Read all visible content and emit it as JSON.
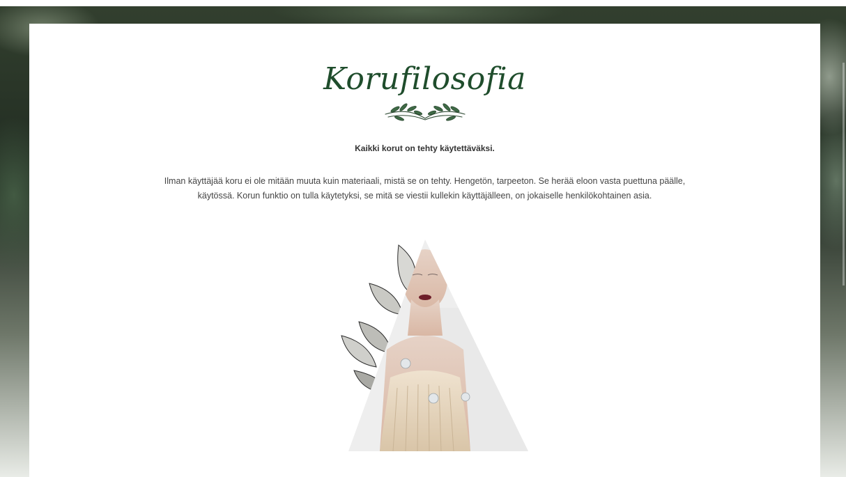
{
  "page": {
    "title": "Korufilosofia",
    "subheading": "Kaikki korut on tehty käytettäväksi.",
    "body": "Ilman käyttäjää koru ei ole mitään muuta kuin materiaali, mistä se on tehty. Hengetön, tarpeeton. Se herää eloon vasta puettuna päälle, käytössä. Korun funktio on tulla käytetyksi, se mitä se viestii kullekin käyttäjälleen, on jokaiselle henkilökohtainen asia."
  },
  "icons": {
    "ornament": "leaf-branch-divider-icon",
    "hero": "leaf-illustration-icon"
  },
  "colors": {
    "title": "#1f4d2c",
    "text": "#444444",
    "card": "#ffffff"
  }
}
